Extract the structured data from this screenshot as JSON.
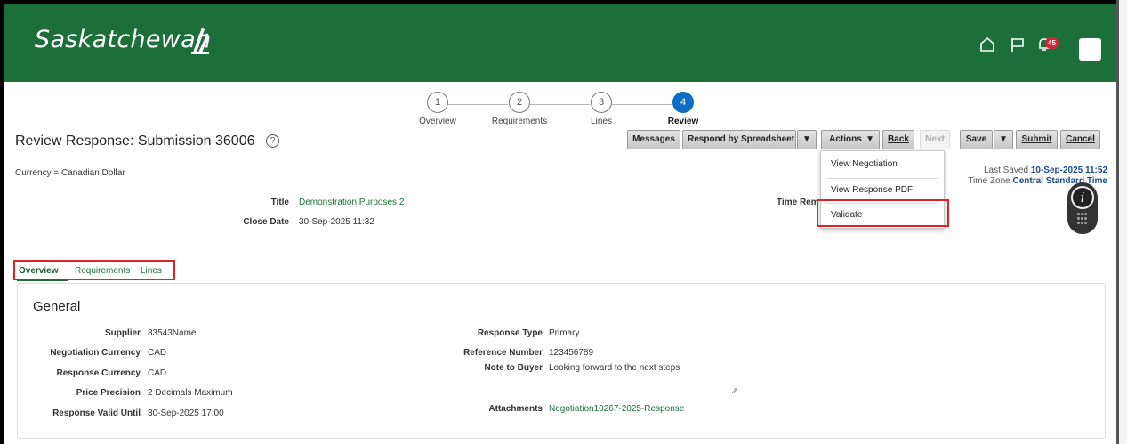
{
  "header": {
    "logo_text": "Saskatchewan",
    "bell_count": "45",
    "brand_color": "#1d6f3a",
    "icons": [
      "home-icon",
      "flag-icon",
      "bell-icon",
      "avatar"
    ]
  },
  "train": {
    "steps": [
      {
        "number": "1",
        "label": "Overview"
      },
      {
        "number": "2",
        "label": "Requirements"
      },
      {
        "number": "3",
        "label": "Lines"
      },
      {
        "number": "4",
        "label": "Review",
        "active": true
      }
    ]
  },
  "page": {
    "title": "Review Response: Submission 36006",
    "help_glyph": "?",
    "currency": "Currency = Canadian Dollar"
  },
  "toolbar": {
    "messages": "Messages",
    "respond_by_spreadsheet": "Respond by Spreadsheet",
    "actions": "Actions",
    "back": "Back",
    "next": "Next",
    "save": "Save",
    "submit": "Submit",
    "cancel": "Cancel",
    "arrow": "▼"
  },
  "status": {
    "last_saved_label": "Last Saved",
    "last_saved_value": "10-Sep-2025 11:52",
    "timezone_label": "Time Zone",
    "timezone_value": "Central Standard Time"
  },
  "summary": {
    "title_label": "Title",
    "title_value": "Demonstration Purposes 2",
    "close_date_label": "Close Date",
    "close_date_value": "30-Sep-2025 11:32",
    "time_remaining_label": "Time Rem"
  },
  "actions_menu": {
    "items": [
      "View Negotiation",
      "View Response PDF",
      "Validate"
    ],
    "highlighted": "Validate"
  },
  "help_widget": {
    "glyph": "i"
  },
  "tabs": {
    "items": [
      "Overview",
      "Requirements",
      "Lines"
    ],
    "active": "Overview"
  },
  "general": {
    "heading": "General",
    "left": [
      {
        "label": "Supplier",
        "value": "83543Name"
      },
      {
        "label": "Negotiation Currency",
        "value": "CAD"
      },
      {
        "label": "Response Currency",
        "value": "CAD"
      },
      {
        "label": "Price Precision",
        "value": "2 Decimals Maximum"
      },
      {
        "label": "Response Valid Until",
        "value": "30-Sep-2025 17:00"
      }
    ],
    "right": [
      {
        "label": "Response Type",
        "value": "Primary"
      },
      {
        "label": "Reference Number",
        "value": "123456789"
      },
      {
        "label": "Note to Buyer",
        "value": "Looking forward to the next steps"
      },
      {
        "label": "Attachments",
        "value": "Negotiation10267-2025-Response"
      }
    ]
  }
}
